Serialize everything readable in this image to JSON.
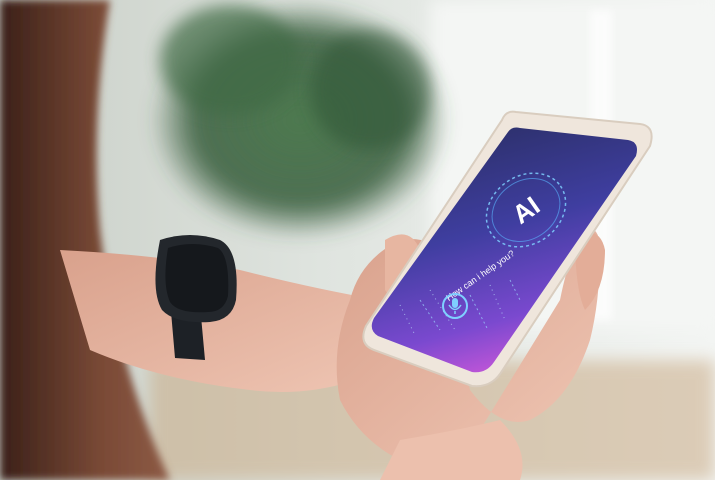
{
  "scene": {
    "ai_badge_text": "AI",
    "prompt_text": "How can i help you?",
    "mic_icon": "microphone-icon",
    "colors": {
      "background_light": "#eef1ee",
      "plant_green": "#3f6b45",
      "phone_case": "#efe6dc",
      "screen_top": "#2b2f6e",
      "screen_bottom": "#c04fd6",
      "watch_band": "#1d2126",
      "skin": "#e9b9a5",
      "hair": "#5a3325"
    }
  }
}
